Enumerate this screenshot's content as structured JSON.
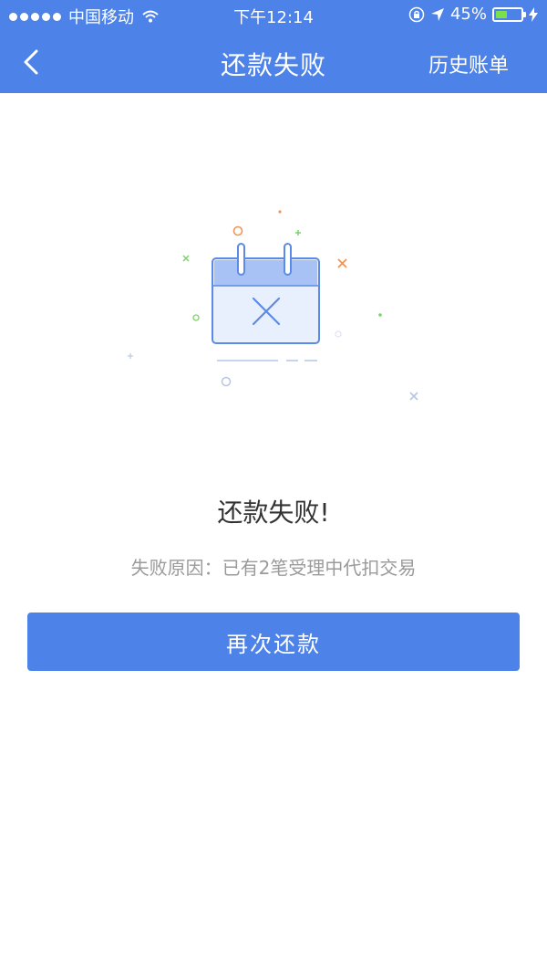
{
  "status_bar": {
    "carrier": "中国移动",
    "time": "下午12:14",
    "battery": "45%",
    "battery_level": 0.45,
    "icons": [
      "signal-dots-icon",
      "wifi-icon",
      "orientation-lock-icon",
      "location-arrow-icon",
      "battery-icon",
      "charging-bolt-icon"
    ]
  },
  "nav": {
    "title": "还款失败",
    "history_label": "历史账单",
    "back_icon": "chevron-left-icon"
  },
  "result": {
    "title": "还款失败!",
    "reason": "失败原因：已有2笔受理中代扣交易",
    "illustration_icon": "calendar-failed-icon"
  },
  "action": {
    "retry_label": "再次还款"
  },
  "colors": {
    "primary": "#4d82e8",
    "battery_green": "#7be14b",
    "title_text": "#333333",
    "subtitle_text": "#9a9a9a",
    "calendar_fill": "#e9f0fd",
    "calendar_header": "#a9c2f5"
  }
}
